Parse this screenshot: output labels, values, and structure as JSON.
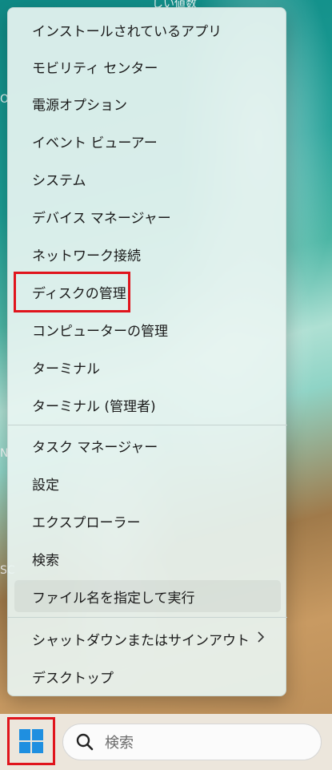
{
  "desktop": {
    "fragments": [
      "しい値数",
      "O",
      "N",
      "SC"
    ]
  },
  "menu": {
    "items": [
      {
        "label": "インストールされているアプリ"
      },
      {
        "label": "モビリティ センター"
      },
      {
        "label": "電源オプション"
      },
      {
        "label": "イベント ビューアー"
      },
      {
        "label": "システム"
      },
      {
        "label": "デバイス マネージャー"
      },
      {
        "label": "ネットワーク接続"
      },
      {
        "label": "ディスクの管理"
      },
      {
        "label": "コンピューターの管理"
      },
      {
        "label": "ターミナル"
      },
      {
        "label": "ターミナル (管理者)"
      },
      {
        "label": "タスク マネージャー"
      },
      {
        "label": "設定"
      },
      {
        "label": "エクスプローラー"
      },
      {
        "label": "検索"
      },
      {
        "label": "ファイル名を指定して実行"
      },
      {
        "label": "シャットダウンまたはサインアウト",
        "submenu": true
      },
      {
        "label": "デスクトップ"
      }
    ],
    "highlighted_item": "ファイル名を指定して実行",
    "outlined_item": "ディスクの管理",
    "submenu_icon": "chevron-right-icon"
  },
  "taskbar": {
    "start_icon": "windows-logo-icon",
    "search_icon": "search-icon",
    "search_placeholder": "検索"
  },
  "colors": {
    "outline": "#e0141c",
    "windows_blue": "#1f8fe0"
  }
}
